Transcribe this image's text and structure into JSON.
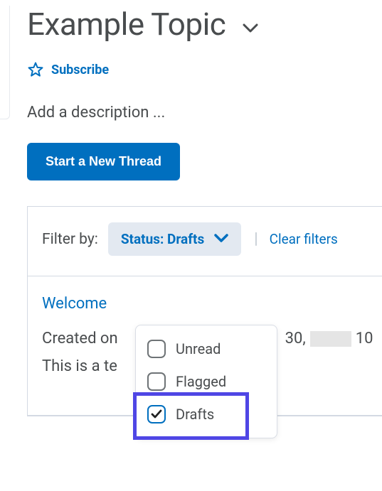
{
  "topic": {
    "title": "Example Topic"
  },
  "subscribe": {
    "label": "Subscribe"
  },
  "description": {
    "placeholder": "Add a description ..."
  },
  "actions": {
    "new_thread": "Start a New Thread"
  },
  "filter": {
    "label": "Filter by:",
    "status_label": "Status: Drafts",
    "clear": "Clear filters",
    "options": {
      "unread": "Unread",
      "flagged": "Flagged",
      "drafts": "Drafts"
    },
    "selected": "drafts"
  },
  "thread": {
    "title": "Welcome",
    "created_prefix": "Created on",
    "created_day": "30,",
    "created_time_partial": "10",
    "preview": "This is a te"
  }
}
